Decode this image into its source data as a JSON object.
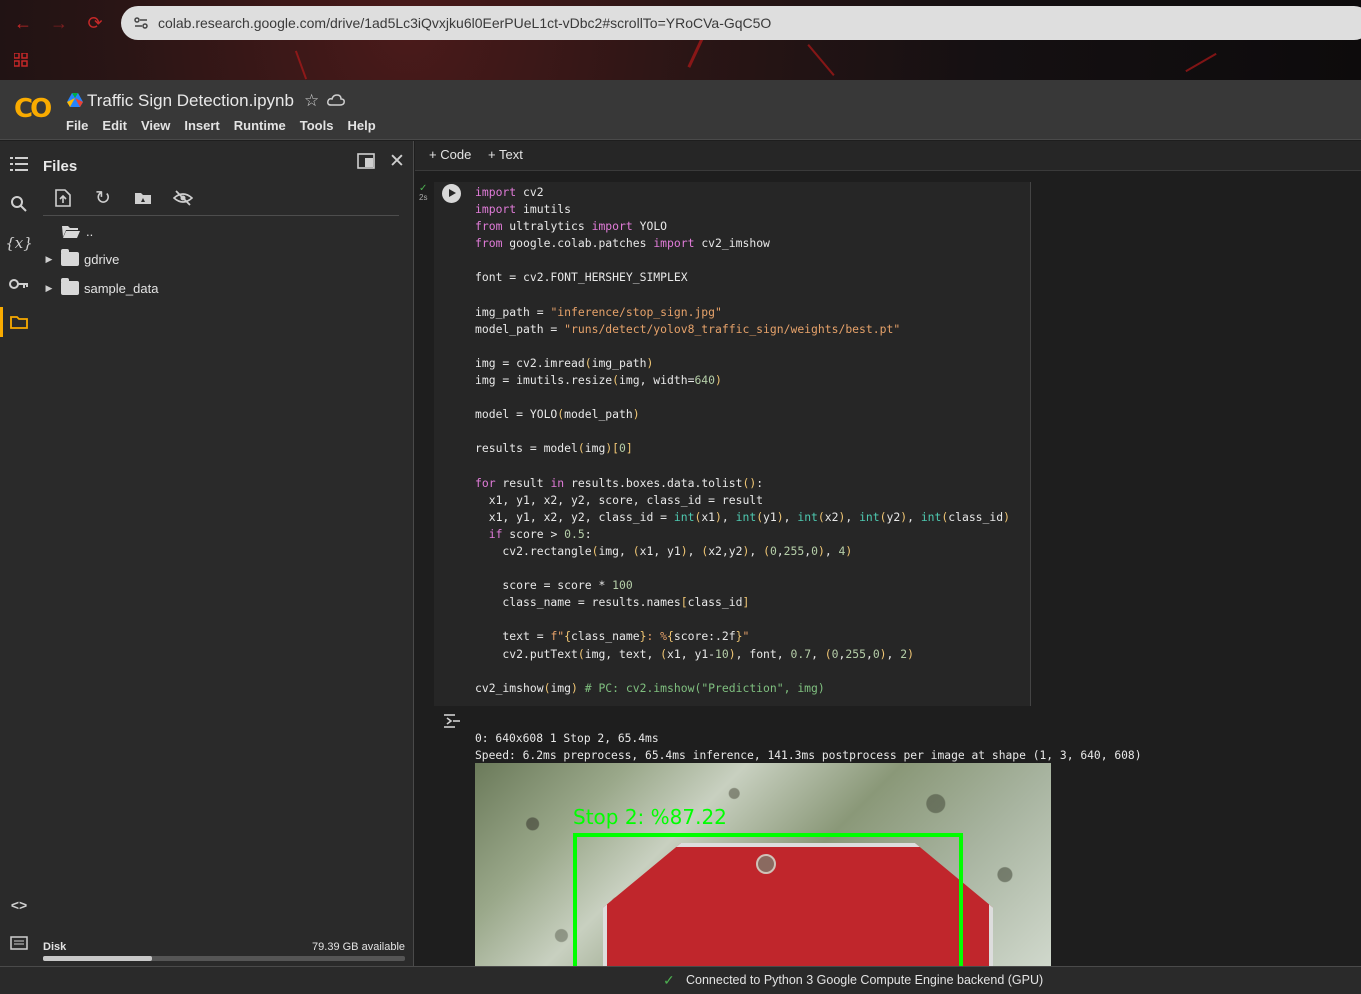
{
  "browser": {
    "url": "colab.research.google.com/drive/1ad5Lc3iQvxjku6l0EerPUeL1ct-vDbc2#scrollTo=YRoCVa-GqC5O",
    "back_icon": "back-arrow-icon",
    "forward_icon": "forward-arrow-icon",
    "reload_icon": "reload-icon"
  },
  "header": {
    "logo": "CO",
    "notebook_title": "Traffic Sign Detection.ipynb",
    "menu": [
      "File",
      "Edit",
      "View",
      "Insert",
      "Runtime",
      "Tools",
      "Help"
    ]
  },
  "files_panel": {
    "title": "Files",
    "tree": [
      {
        "label": "..",
        "expandable": false
      },
      {
        "label": "gdrive",
        "expandable": true
      },
      {
        "label": "sample_data",
        "expandable": true
      }
    ],
    "disk_label": "Disk",
    "disk_available": "79.39 GB available",
    "disk_used_fraction": 0.3
  },
  "notebook": {
    "add_code": "Code",
    "add_text": "Text",
    "exec_time": "2s",
    "output_line1": "0: 640x608 1 Stop 2, 65.4ms",
    "output_line2": "Speed: 6.2ms preprocess, 65.4ms inference, 141.3ms postprocess per image at shape (1, 3, 640, 608)",
    "detection_label": "Stop 2: %87.22"
  },
  "status": {
    "text": "Connected to Python 3 Google Compute Engine backend (GPU)"
  },
  "colors": {
    "accent": "#f9ab00",
    "success": "#4caf50",
    "bbox": "#00ff00"
  }
}
